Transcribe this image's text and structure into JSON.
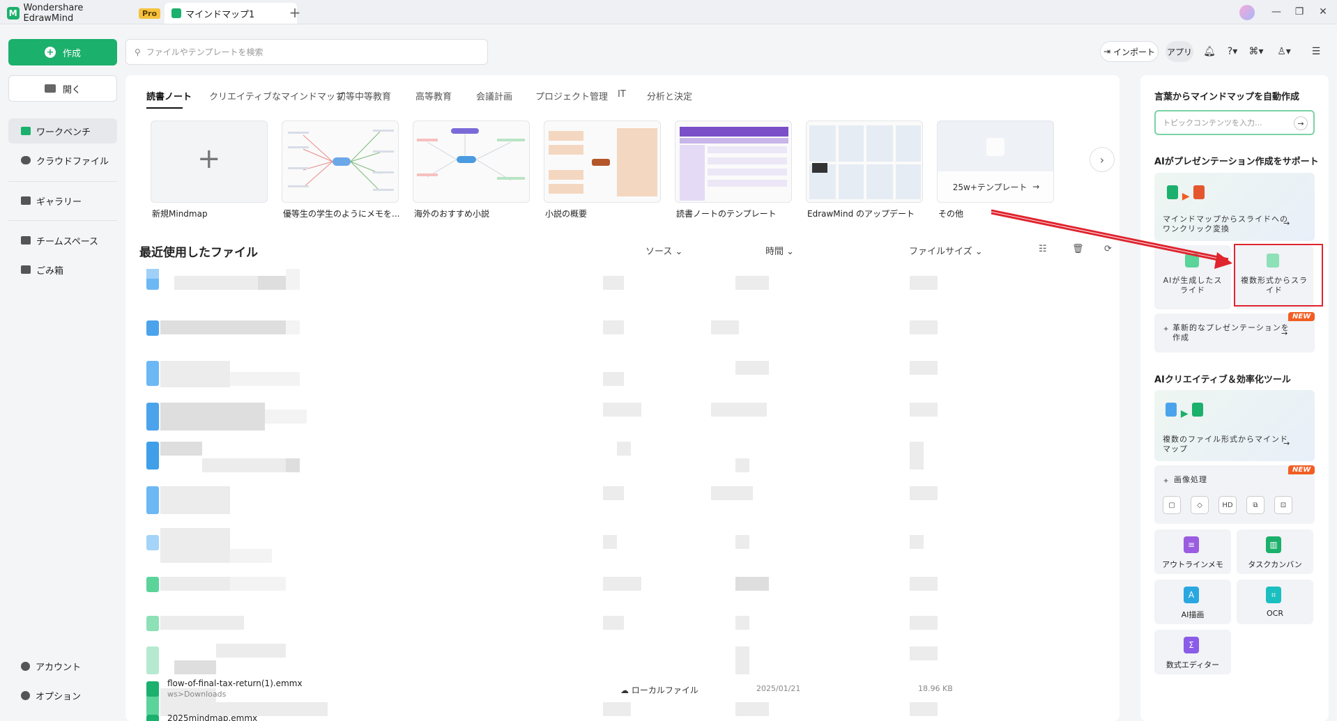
{
  "titlebar": {
    "app_name": "Wondershare EdrawMind",
    "pro_badge": "Pro",
    "doc_tab": "マインドマップ1",
    "new_tab_icon": "+"
  },
  "sidebar": {
    "create": "作成",
    "open": "開く",
    "items": [
      {
        "label": "ワークベンチ",
        "active": true
      },
      {
        "label": "クラウドファイル"
      },
      {
        "label": "ギャラリー"
      },
      {
        "label": "チームスペース"
      },
      {
        "label": "ごみ箱"
      }
    ],
    "bottom": [
      {
        "label": "アカウント"
      },
      {
        "label": "オプション"
      }
    ]
  },
  "search": {
    "placeholder": "ファイルやテンプレートを検索"
  },
  "toolbar": {
    "import": "インポート",
    "app": "アプリ"
  },
  "categories": [
    "読書ノート",
    "クリエイティブなマインドマップ",
    "初等中等教育",
    "高等教育",
    "会議計画",
    "プロジェクト管理",
    "IT",
    "分析と決定"
  ],
  "templates": [
    {
      "label": "新規Mindmap"
    },
    {
      "label": "優等生の学生のようにメモを..."
    },
    {
      "label": "海外のおすすめ小説"
    },
    {
      "label": "小説の概要"
    },
    {
      "label": "読書ノートのテンプレート"
    },
    {
      "label": "EdrawMind のアップデート"
    },
    {
      "label": "その他",
      "overlay": "25w+テンプレート"
    }
  ],
  "recent": {
    "title": "最近使用したファイル",
    "col_source": "ソース",
    "col_time": "時間",
    "col_size": "ファイルサイズ",
    "files": [
      {
        "name": "flow-of-final-tax-return(1).emmx",
        "path": "ws>Downloads",
        "source": "ローカルファイル",
        "time": "2025/01/21",
        "size": "18.96 KB"
      },
      {
        "name": "2025mindmap.emmx"
      }
    ]
  },
  "right_panel": {
    "ai_heading": "言葉からマインドマップを自動作成",
    "topic_placeholder": "トピックコンテンツを入力...",
    "pres_heading": "AIがプレゼンテーション作成をサポート",
    "pres_card": "マインドマップからスライドへのワンクリック変換",
    "ai_slide": "AIが生成したスライド",
    "multi_slide": "複数形式からスライド",
    "innov_pres": "革新的なプレゼンテーションを作成",
    "new_badge": "NEW",
    "creative_heading": "AIクリエイティブ＆効率化ツール",
    "multi_file": "複数のファイル形式からマインドマップ",
    "image_proc": "画像処理",
    "tools": [
      "アウトラインメモ",
      "タスクカンバン",
      "AI描画",
      "OCR",
      "数式エディター"
    ]
  },
  "colors": {
    "brand": "#1bb06c",
    "highlight": "#e0242e",
    "new_badge": "#f25d22"
  }
}
